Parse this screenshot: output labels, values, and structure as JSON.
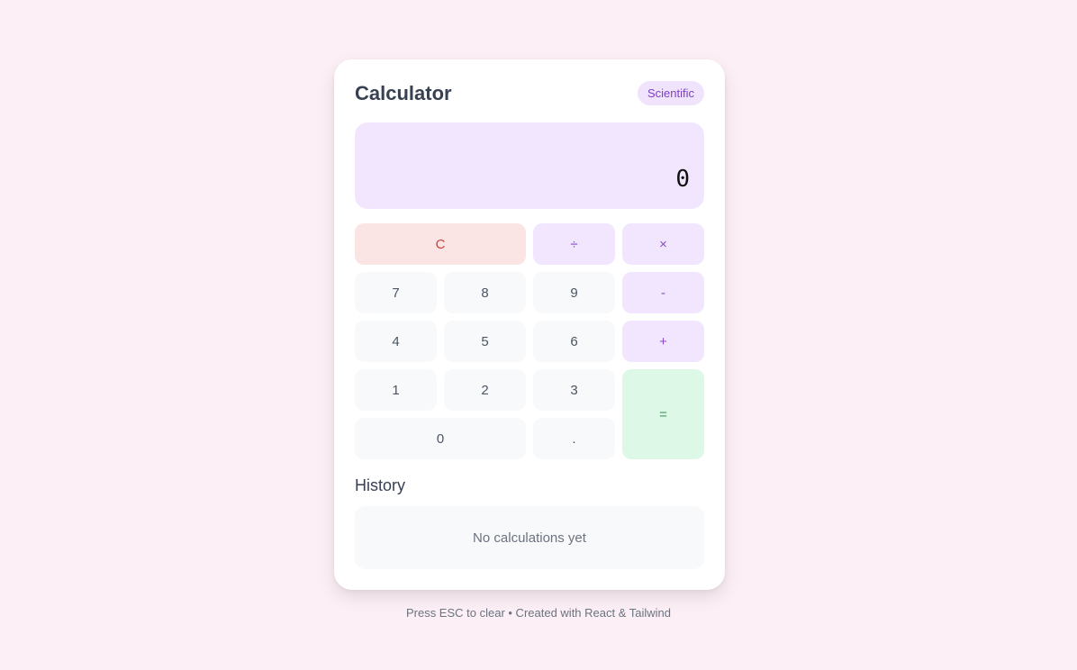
{
  "header": {
    "title": "Calculator",
    "badge": "Scientific"
  },
  "display": {
    "value": "0"
  },
  "keys": {
    "clear": "C",
    "divide": "÷",
    "multiply": "×",
    "subtract": "-",
    "add": "+",
    "equals": "=",
    "decimal": ".",
    "seven": "7",
    "eight": "8",
    "nine": "9",
    "four": "4",
    "five": "5",
    "six": "6",
    "one": "1",
    "two": "2",
    "three": "3",
    "zero": "0"
  },
  "history": {
    "title": "History",
    "empty_text": "No calculations yet"
  },
  "footer": {
    "text": "Press ESC to clear • Created with React & Tailwind"
  },
  "colors": {
    "background": "#fcf0f6",
    "accent": "#8a4bc9",
    "clear": "#c4463f",
    "equals": "#3d9a5d"
  }
}
